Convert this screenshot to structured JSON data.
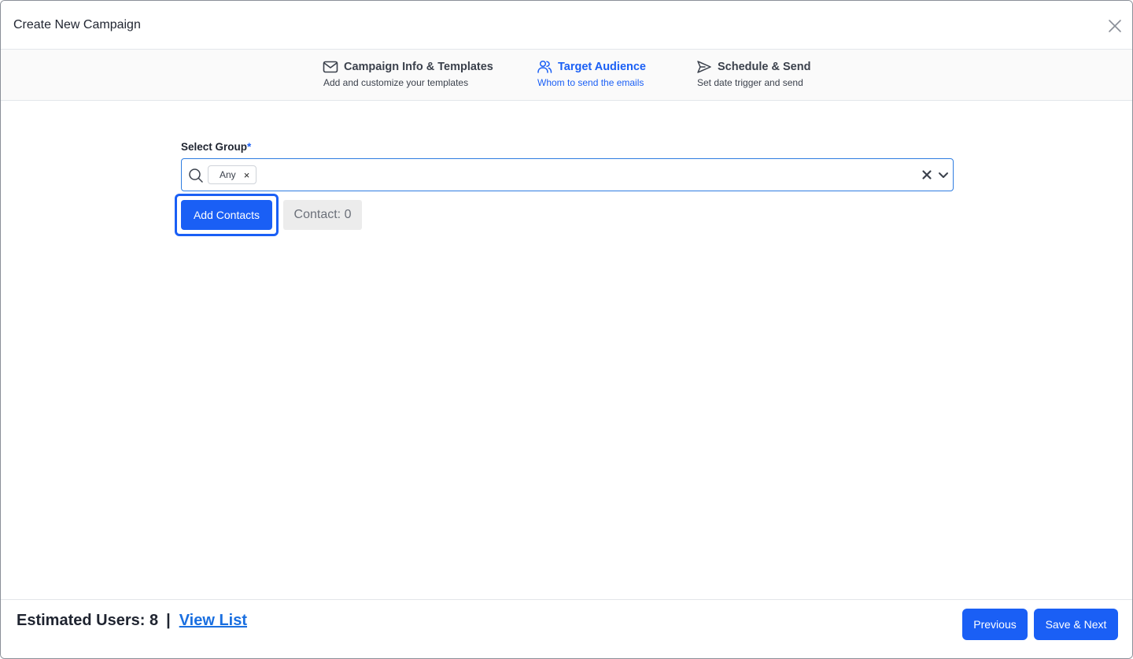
{
  "modal": {
    "title": "Create New Campaign",
    "close_icon": "close-icon"
  },
  "stepper": {
    "steps": [
      {
        "title": "Campaign Info & Templates",
        "subtitle": "Add and customize your templates",
        "icon": "mail-icon",
        "active": false
      },
      {
        "title": "Target Audience",
        "subtitle": "Whom to send the emails",
        "icon": "users-icon",
        "active": true
      },
      {
        "title": "Schedule & Send",
        "subtitle": "Set date trigger and send",
        "icon": "send-icon",
        "active": false
      }
    ]
  },
  "form": {
    "group_label": "Select Group",
    "required_mark": "*",
    "selected_chips": [
      "Any"
    ],
    "chip_remove_glyph": "×",
    "add_contacts_label": "Add Contacts",
    "contact_count_label": "Contact: 0"
  },
  "footer": {
    "estimated_users_label": "Estimated Users: 8",
    "separator": "|",
    "view_list_label": "View List",
    "previous_label": "Previous",
    "next_label": "Save & Next"
  },
  "colors": {
    "accent": "#1a5ff5",
    "link": "#1a6fe0",
    "border_focus": "#2f7de1"
  }
}
